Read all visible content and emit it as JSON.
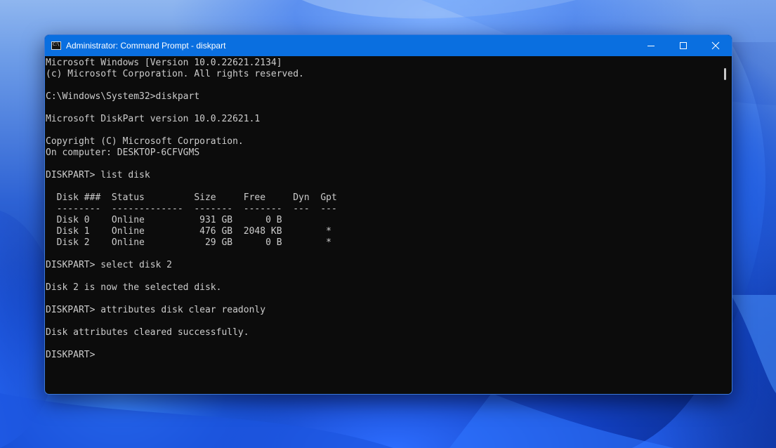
{
  "window": {
    "title": "Administrator: Command Prompt - diskpart",
    "app_icon_text": "C:\\",
    "controls": [
      "minimize",
      "maximize",
      "close"
    ]
  },
  "console": {
    "lines": [
      "Microsoft Windows [Version 10.0.22621.2134]",
      "(c) Microsoft Corporation. All rights reserved.",
      "",
      "C:\\Windows\\System32>diskpart",
      "",
      "Microsoft DiskPart version 10.0.22621.1",
      "",
      "Copyright (C) Microsoft Corporation.",
      "On computer: DESKTOP-6CFVGMS",
      "",
      "DISKPART> list disk",
      "",
      "  Disk ###  Status         Size     Free     Dyn  Gpt",
      "  --------  -------------  -------  -------  ---  ---",
      "  Disk 0    Online          931 GB      0 B",
      "  Disk 1    Online          476 GB  2048 KB        *",
      "  Disk 2    Online           29 GB      0 B        *",
      "",
      "DISKPART> select disk 2",
      "",
      "Disk 2 is now the selected disk.",
      "",
      "DISKPART> attributes disk clear readonly",
      "",
      "Disk attributes cleared successfully.",
      "",
      "DISKPART> "
    ]
  },
  "colors": {
    "titlebar": "#0a6fe0",
    "console_bg": "#0c0c0c",
    "console_text": "#cccccc"
  }
}
